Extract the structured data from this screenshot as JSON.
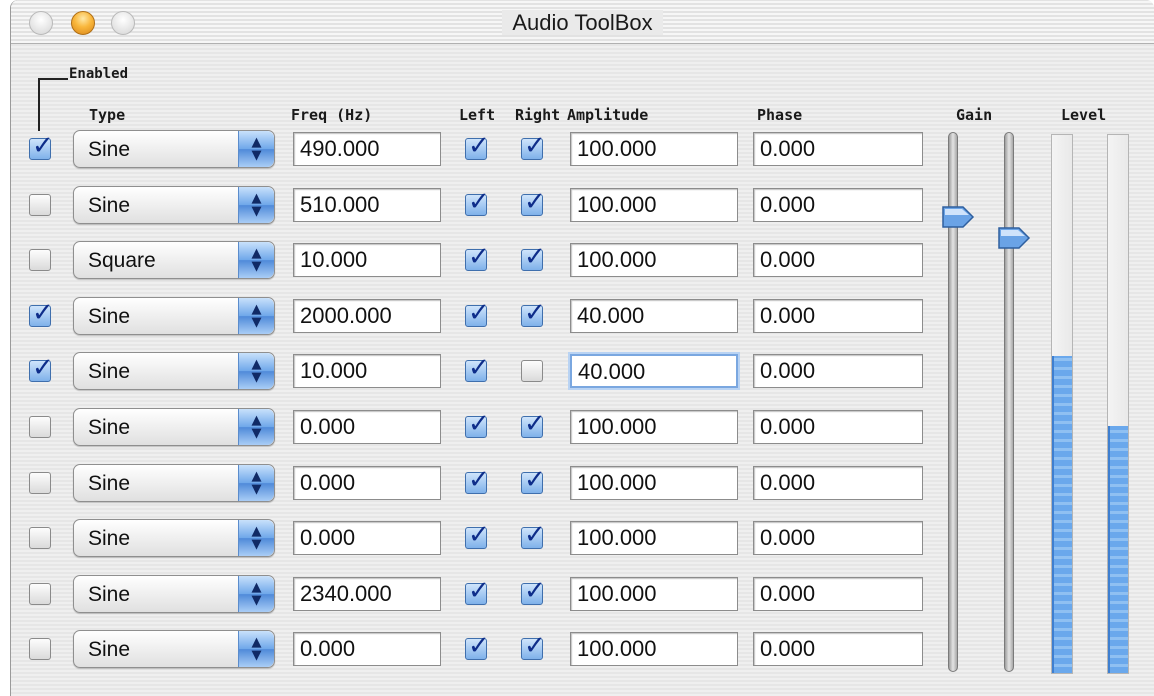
{
  "window": {
    "title": "Audio ToolBox",
    "accent_color": "#5b9be6"
  },
  "headers": {
    "enabled": "Enabled",
    "type": "Type",
    "freq": "Freq (Hz)",
    "left": "Left",
    "right": "Right",
    "amplitude": "Amplitude",
    "phase": "Phase",
    "gain": "Gain",
    "level": "Level"
  },
  "rows": [
    {
      "enabled": true,
      "type": "Sine",
      "freq": "490.000",
      "left": true,
      "right": true,
      "amplitude": "100.000",
      "phase": "0.000"
    },
    {
      "enabled": false,
      "type": "Sine",
      "freq": "510.000",
      "left": true,
      "right": true,
      "amplitude": "100.000",
      "phase": "0.000"
    },
    {
      "enabled": false,
      "type": "Square",
      "freq": "10.000",
      "left": true,
      "right": true,
      "amplitude": "100.000",
      "phase": "0.000"
    },
    {
      "enabled": true,
      "type": "Sine",
      "freq": "2000.000",
      "left": true,
      "right": true,
      "amplitude": "40.000",
      "phase": "0.000"
    },
    {
      "enabled": true,
      "type": "Sine",
      "freq": "10.000",
      "left": true,
      "right": false,
      "amplitude": "40.000",
      "phase": "0.000",
      "amp_focused": true
    },
    {
      "enabled": false,
      "type": "Sine",
      "freq": "0.000",
      "left": true,
      "right": true,
      "amplitude": "100.000",
      "phase": "0.000"
    },
    {
      "enabled": false,
      "type": "Sine",
      "freq": "0.000",
      "left": true,
      "right": true,
      "amplitude": "100.000",
      "phase": "0.000"
    },
    {
      "enabled": false,
      "type": "Sine",
      "freq": "0.000",
      "left": true,
      "right": true,
      "amplitude": "100.000",
      "phase": "0.000"
    },
    {
      "enabled": false,
      "type": "Sine",
      "freq": "2340.000",
      "left": true,
      "right": true,
      "amplitude": "100.000",
      "phase": "0.000"
    },
    {
      "enabled": false,
      "type": "Sine",
      "freq": "0.000",
      "left": true,
      "right": true,
      "amplitude": "100.000",
      "phase": "0.000"
    }
  ],
  "gain": {
    "left_level": 0.86,
    "right_level": 0.82
  },
  "level": {
    "left_fill": 0.59,
    "right_fill": 0.46
  }
}
